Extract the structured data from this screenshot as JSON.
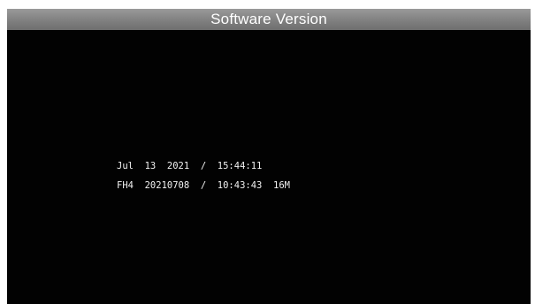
{
  "screen": {
    "title": "Software Version"
  },
  "version_info": {
    "lines": [
      "Jul  13  2021  /  15:44:11",
      "FH4  20210708  /  10:43:43  16M"
    ]
  },
  "colors": {
    "title_bar": "#808080",
    "background": "#000000",
    "text": "#ffffff"
  }
}
